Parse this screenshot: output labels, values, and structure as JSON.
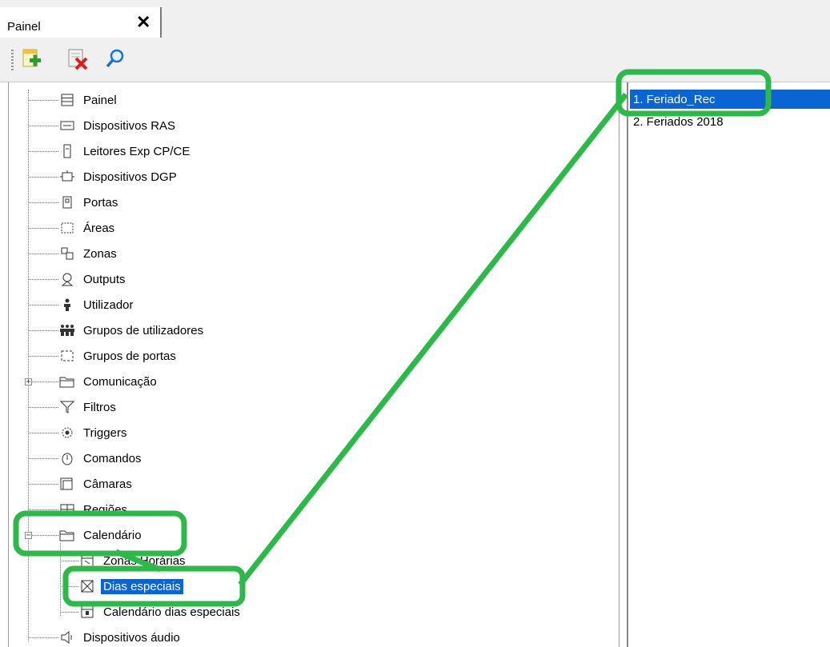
{
  "tab": {
    "label": "Painel",
    "close_symbol": "✕"
  },
  "toolbar": {
    "buttons": [
      {
        "name": "new-item-button",
        "icon": "add-document-icon"
      },
      {
        "name": "delete-item-button",
        "icon": "delete-document-icon"
      },
      {
        "name": "search-button",
        "icon": "magnifier-icon"
      }
    ]
  },
  "tree": {
    "items": [
      {
        "label": "Painel",
        "icon": "panel-icon"
      },
      {
        "label": "Dispositivos RAS",
        "icon": "ras-device-icon"
      },
      {
        "label": "Leitores Exp CP/CE",
        "icon": "reader-icon"
      },
      {
        "label": "Dispositivos DGP",
        "icon": "dgp-device-icon"
      },
      {
        "label": "Portas",
        "icon": "door-icon"
      },
      {
        "label": "Áreas",
        "icon": "area-icon"
      },
      {
        "label": "Zonas",
        "icon": "zone-icon"
      },
      {
        "label": "Outputs",
        "icon": "output-icon"
      },
      {
        "label": "Utilizador",
        "icon": "user-icon"
      },
      {
        "label": "Grupos de utilizadores",
        "icon": "user-group-icon"
      },
      {
        "label": "Grupos de portas",
        "icon": "door-group-icon"
      },
      {
        "label": "Comunicação",
        "icon": "folder-icon",
        "expander": "+"
      },
      {
        "label": "Filtros",
        "icon": "filter-icon"
      },
      {
        "label": "Triggers",
        "icon": "trigger-icon"
      },
      {
        "label": "Comandos",
        "icon": "command-icon"
      },
      {
        "label": "Câmaras",
        "icon": "camera-icon"
      },
      {
        "label": "Regiões",
        "icon": "region-icon"
      },
      {
        "label": "Calendário",
        "icon": "folder-icon",
        "expander": "−"
      },
      {
        "label": "Zonas Horárias",
        "icon": "time-zone-icon"
      },
      {
        "label": "Dias especiais",
        "icon": "special-days-icon",
        "selected": true
      },
      {
        "label": "Calendário dias especiais",
        "icon": "calendar-icon"
      },
      {
        "label": "Dispositivos áudio",
        "icon": "speaker-icon"
      }
    ]
  },
  "list": {
    "items": [
      {
        "label": "1. Feriado_Rec",
        "selected": true
      },
      {
        "label": "2. Feriados 2018",
        "selected": false
      }
    ]
  },
  "colors": {
    "selection": "#0a64d2",
    "highlight": "#2db84a"
  }
}
